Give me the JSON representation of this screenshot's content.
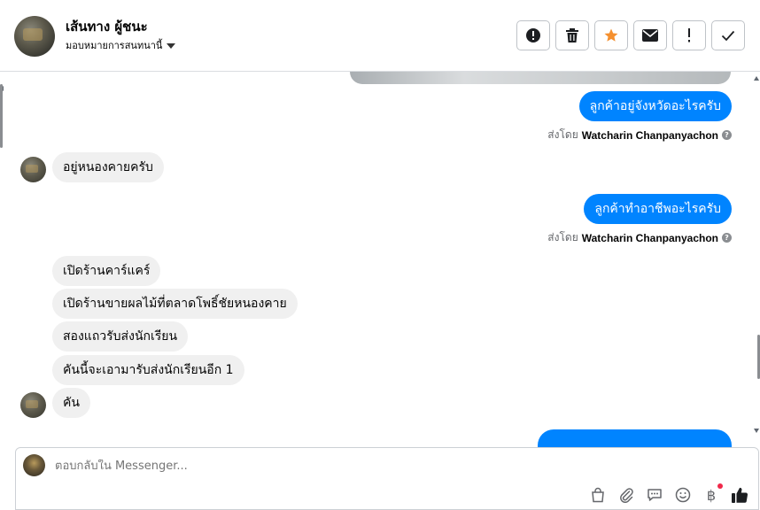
{
  "header": {
    "name": "เส้นทาง ผู้ชนะ",
    "subtitle": "มอบหมายการสนทนานี้"
  },
  "toolbar": {
    "buttons": [
      {
        "name": "alert-circle-icon"
      },
      {
        "name": "trash-icon"
      },
      {
        "name": "star-icon",
        "color": "#f5902f"
      },
      {
        "name": "envelope-icon"
      },
      {
        "name": "exclamation-icon"
      },
      {
        "name": "check-icon"
      }
    ]
  },
  "messages": {
    "m1": "ลูกค้าอยู่จังหวัดอะไรครับ",
    "sent1_prefix": "ส่งโดย",
    "sent1_name": "Watcharin Chanpanyachon",
    "m2": "อยู่หนองคายครับ",
    "m3": "ลูกค้าทำอาชีพอะไรครับ",
    "sent2_prefix": "ส่งโดย",
    "sent2_name": "Watcharin Chanpanyachon",
    "m4": "เปิดร้านคาร์แคร์",
    "m5": "เปิดร้านขายผลไม้ที่ตลาดโพธิ์ชัยหนองคาย",
    "m6": "สองแถวรับส่งนักเรียน",
    "m7": "คันนี้จะเอามารับส่งนักเรียนอีก 1",
    "m8": "คัน"
  },
  "composer": {
    "placeholder": "ตอบกลับใน Messenger..."
  },
  "colors": {
    "outgoing_bubble": "#0084ff",
    "incoming_bubble": "#f0f0f0",
    "accent_like": "#050505"
  }
}
